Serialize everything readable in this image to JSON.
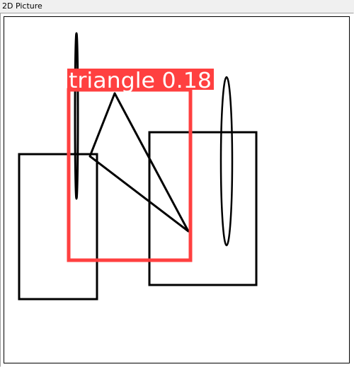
{
  "window": {
    "title": "2D Picture"
  },
  "canvas": {
    "background_color": "#ffffff",
    "stroke_color": "#000000"
  },
  "detection": {
    "class_label": "triangle",
    "confidence": "0.18",
    "box_color": "#ff4040",
    "label_text_color": "#ffffff"
  }
}
